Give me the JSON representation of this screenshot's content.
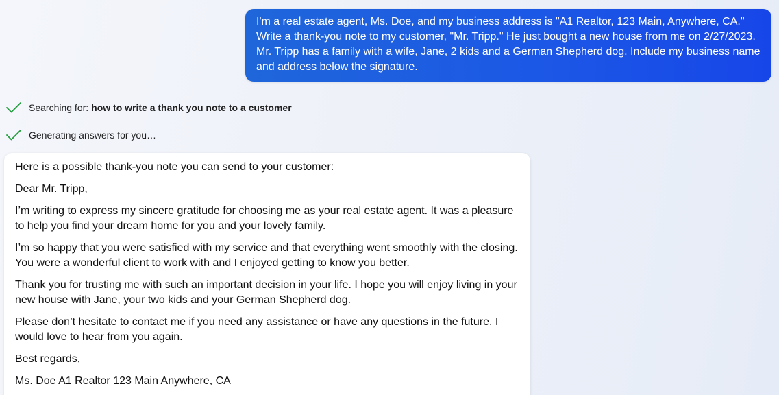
{
  "user_message": {
    "text": "I'm a real estate agent, Ms. Doe, and my business address is \"A1 Realtor, 123 Main, Anywhere, CA.\" Write a thank-you note to my customer, \"Mr. Tripp.\" He just bought a new house from me on 2/27/2023. Mr. Tripp has a family with a wife, Jane, 2 kids and a German Shepherd dog. Include my business name and address below the signature."
  },
  "status": {
    "searching_label": "Searching for:",
    "searching_query": "how to write a thank you note to a customer",
    "generating_label": "Generating answers for you…"
  },
  "response": {
    "intro": "Here is a possible thank-you note you can send to your customer:",
    "greeting": "Dear Mr. Tripp,",
    "paragraph_1": "I’m writing to express my sincere gratitude for choosing me as your real estate agent. It was a pleasure to help you find your dream home for you and your lovely family.",
    "paragraph_2": "I’m so happy that you were satisfied with my service and that everything went smoothly with the closing. You were a wonderful client to work with and I enjoyed getting to know you better.",
    "paragraph_3": "Thank you for trusting me with such an important decision in your life. I hope you will enjoy living in your new house with Jane, your two kids and your German Shepherd dog.",
    "paragraph_4": "Please don’t hesitate to contact me if you need any assistance or have any questions in the future. I would love to hear from you again.",
    "closing": "Best regards,",
    "signature": "Ms. Doe A1 Realtor 123 Main Anywhere, CA"
  },
  "icons": {
    "status_check": "check-icon"
  },
  "colors": {
    "user_bubble_start": "#1f66da",
    "user_bubble_end": "#1746e8",
    "check_green": "#1f9d3a",
    "card_background": "#ffffff"
  }
}
